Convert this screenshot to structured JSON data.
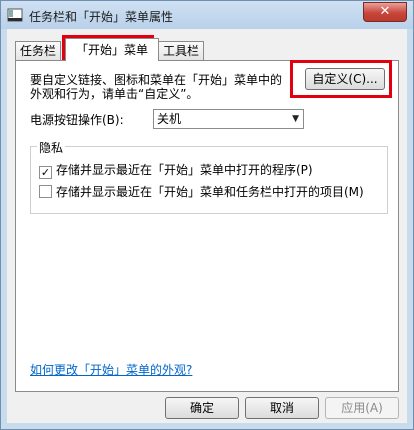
{
  "window": {
    "title": "任务栏和「开始」菜单属性",
    "close_label": "✕"
  },
  "tabs": [
    {
      "label": "任务栏",
      "selected": false
    },
    {
      "label": "「开始」菜单",
      "selected": true
    },
    {
      "label": "工具栏",
      "selected": false
    }
  ],
  "start_menu": {
    "description": "要自定义链接、图标和菜单在「开始」菜单中的外观和行为，请单击“自定义”。",
    "customize_button": "自定义(C)...",
    "power_label": "电源按钮操作(B):",
    "power_value": "关机",
    "privacy": {
      "title": "隐私",
      "options": [
        {
          "label": "存储并显示最近在「开始」菜单中打开的程序(P)",
          "checked": true
        },
        {
          "label": "存储并显示最近在「开始」菜单和任务栏中打开的项目(M)",
          "checked": false
        }
      ]
    },
    "help_link": "如何更改「开始」菜单的外观?"
  },
  "buttons": {
    "ok": "确定",
    "cancel": "取消",
    "apply": "应用(A)"
  },
  "highlight_color": "#e2000f"
}
